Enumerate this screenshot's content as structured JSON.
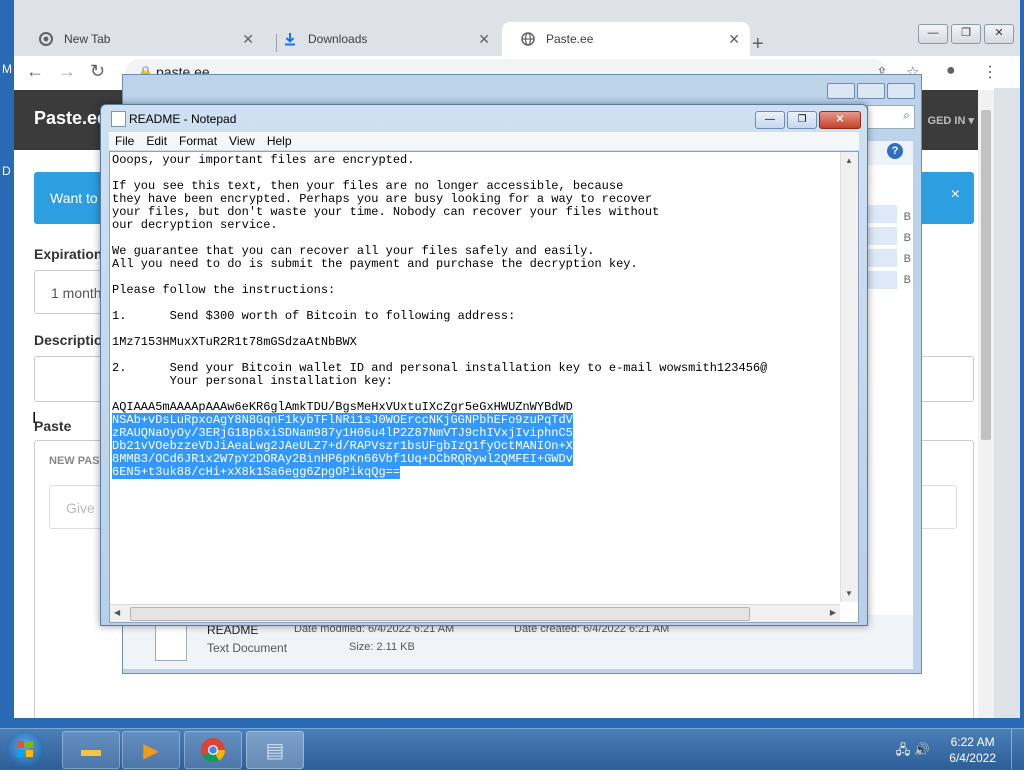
{
  "desktop": {
    "frag_m": "M",
    "frag_d": "D"
  },
  "chrome": {
    "tabs": [
      {
        "label": "New Tab",
        "icon": "chrome-icon"
      },
      {
        "label": "Downloads",
        "icon": "download-icon"
      },
      {
        "label": "Paste.ee",
        "icon": "globe-icon"
      }
    ],
    "close_glyph": "✕",
    "newtab_glyph": "+",
    "win": {
      "min": "—",
      "max": "❐",
      "close": "✕"
    },
    "url": "paste.ee",
    "nav": {
      "back": "←",
      "forward": "→",
      "reload": "↻"
    }
  },
  "pasteee": {
    "brand": "Paste.ee",
    "logged_in": "GED IN ▾",
    "alert_text": "Want to",
    "alert_close": "×",
    "expiration_label": "Expiration",
    "expiration_value": "1 month",
    "description_label": "Description",
    "paste_label": "Paste",
    "new_paste_tab": "NEW PAST",
    "give_placeholder": "Give"
  },
  "explorer": {
    "file_name": "README",
    "file_type": "Text Document",
    "date_modified": "Date modified: 6/4/2022 6:21 AM",
    "date_created": "Date created: 6/4/2022 6:21 AM",
    "size": "Size: 2.11 KB",
    "sizes_col": [
      "B",
      "B",
      "B",
      "B"
    ]
  },
  "notepad": {
    "title": "README - Notepad",
    "menu": [
      "File",
      "Edit",
      "Format",
      "View",
      "Help"
    ],
    "lines_plain": "Ooops, your important files are encrypted.\n\nIf you see this text, then your files are no longer accessible, because\nthey have been encrypted. Perhaps you are busy looking for a way to recover\nyour files, but don't waste your time. Nobody can recover your files without\nour decryption service.\n\nWe guarantee that you can recover all your files safely and easily.\nAll you need to do is submit the payment and purchase the decryption key.\n\nPlease follow the instructions:\n\n1.      Send $300 worth of Bitcoin to following address:\n\n1Mz7153HMuxXTuR2R1t78mGSdzaAtNbBWX\n\n2.      Send your Bitcoin wallet ID and personal installation key to e-mail wowsmith123456@\n        Your personal installation key:\n\nAQIAAA5mAAAApAAAw6eKR6glAmkTDU/BgsMeHxVUxtuIXcZgr5eGxHWUZnWYBdWD",
    "lines_selected": "NSAb+vDsLuRpxoAgY8N8GqnF1kybTFlNRi1sJ0WOErccNKjGGNPbhEFo9zuPqTdV\nzRAUQNaOyOy/3ERjG1Bp6xiSDNam987y1H06u4lP2Z87NmVTJ9chIVxjIviphnC5\nDb21vVOebzzeVDJiAeaLwg2JAeULZ7+d/RAPVszr1bsUFgbIzQ1fyOctMANIOn+X\n8MMB3/OCd6JR1x2W7pY2DORAy2BinHP6pKn66Vbf1Uq+DCbRQRywl2QMFEI+GWDv\n6EN5+t3uk88/cHi+xX8k1Sa6egg6ZpgOPikqQg=="
  },
  "taskbar": {
    "time": "6:22 AM",
    "date": "6/4/2022",
    "tray_icons": "🖧 🔊"
  },
  "colors": {
    "selection": "#3399ff",
    "taskbar": "#2d5e98",
    "alert": "#2d9ee0"
  }
}
